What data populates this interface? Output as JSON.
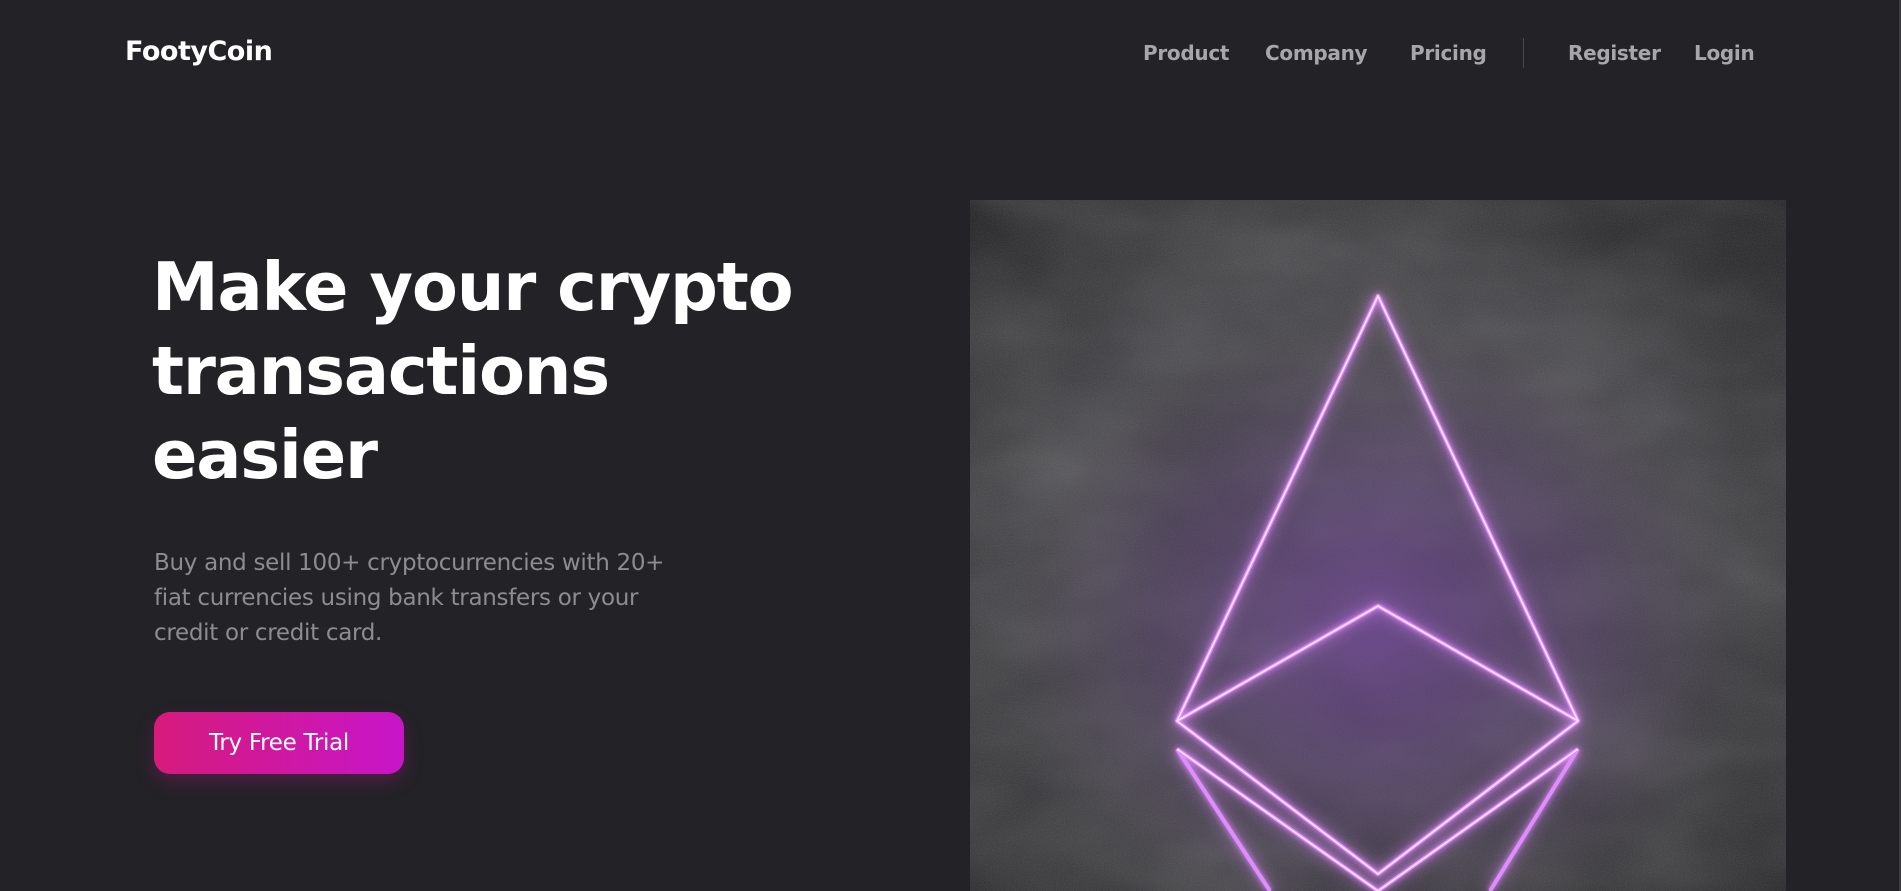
{
  "brand": {
    "name": "FootyCoin"
  },
  "nav": {
    "product": "Product",
    "company": "Company",
    "pricing": "Pricing",
    "register": "Register",
    "login": "Login"
  },
  "hero": {
    "title_lines": [
      "Make your crypto",
      "transactions",
      "easier"
    ],
    "subtitle_lines": [
      "Buy and sell 100+ cryptocurrencies with 20+",
      "fiat currencies using bank transfers or your",
      "credit or credit card."
    ],
    "cta_label": "Try Free Trial",
    "image_icon": "ethereum-icon"
  },
  "colors": {
    "background": "#232227",
    "cta_start": "#d61b7b",
    "cta_end": "#c815c9",
    "neon": "#cf5cff",
    "nav_text": "#a7a6ac",
    "subtitle_text": "#8d8c92"
  }
}
